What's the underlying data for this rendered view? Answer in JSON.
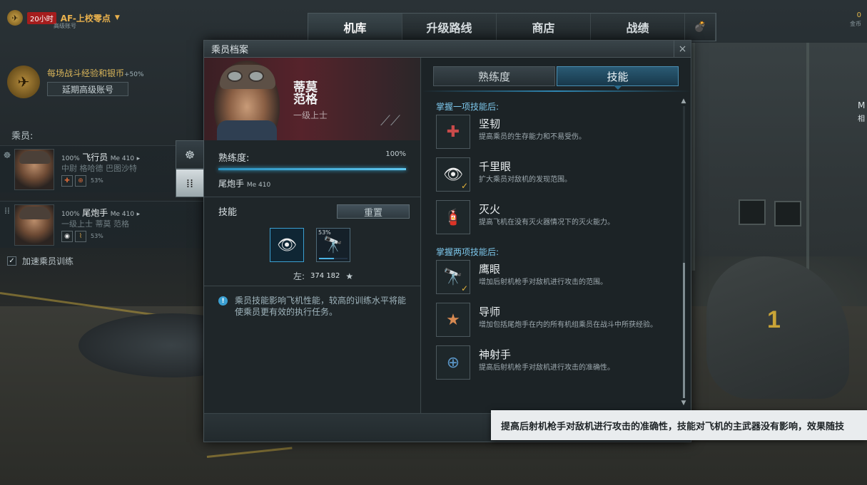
{
  "user": {
    "timer": "20小时",
    "name": "AF-上校零点",
    "subtitle": "高级账号"
  },
  "nav": {
    "tabs": [
      {
        "label": "机库"
      },
      {
        "label": "升级路线"
      },
      {
        "label": "商店"
      },
      {
        "label": "战绩"
      }
    ]
  },
  "gold": {
    "value": "0",
    "label": "金币"
  },
  "premium": {
    "text": "每场战斗经验和银币",
    "bonus": "+50%",
    "button": "延期高级账号"
  },
  "crew": {
    "label": "乘员:",
    "members": [
      {
        "percent": "100%",
        "role": "飞行员",
        "model": "Me 410",
        "name": "中尉 格哈德 巴图沙特",
        "skill_level": "53%"
      },
      {
        "percent": "100%",
        "role": "尾炮手",
        "model": "Me 410",
        "name": "一级上士 蒂莫 范格",
        "skill_level": "53%"
      }
    ],
    "accelerate_label": "加速乘员训练"
  },
  "dialog": {
    "title": "乘员档案",
    "close": "×",
    "crew_name_line1": "蒂莫",
    "crew_name_line2": "范格",
    "crew_rank": "一级上士",
    "proficiency_label": "熟练度:",
    "proficiency_value": "100%",
    "proficiency_fraction": 1.0,
    "role": "尾炮手",
    "role_model": "Me 410",
    "skills_label": "技能",
    "reset_button": "重置",
    "slot_percent": "53%",
    "slot_progress": 0.53,
    "remaining_label": "左:",
    "remaining_value": "374 182",
    "info_text": "乘员技能影响飞机性能，较高的训练水平将能使乘员更有效的执行任务。",
    "tabs": [
      {
        "label": "熟练度"
      },
      {
        "label": "技能"
      }
    ],
    "groups": [
      {
        "title": "掌握一项技能后:",
        "skills": [
          {
            "name": "坚韧",
            "desc": "提高乘员的生存能力和不易受伤。",
            "icon": "medkit-icon",
            "learned": false
          },
          {
            "name": "千里眼",
            "desc": "扩大乘员对敌机的发现范围。",
            "icon": "eye-icon",
            "learned": true
          },
          {
            "name": "灭火",
            "desc": "提高飞机在没有灭火器情况下的灭火能力。",
            "icon": "extinguisher-icon",
            "learned": false
          }
        ]
      },
      {
        "title": "掌握两项技能后:",
        "skills": [
          {
            "name": "鹰眼",
            "desc": "增加后射机枪手对敌机进行攻击的范围。",
            "icon": "telescope-icon",
            "learned": true
          },
          {
            "name": "导师",
            "desc": "增加包括尾炮手在内的所有机组乘员在战斗中所获经验。",
            "icon": "star-book-icon",
            "learned": false
          },
          {
            "name": "神射手",
            "desc": "提高后射机枪手对敌机进行攻击的准确性。",
            "icon": "crosshair-icon",
            "learned": false
          }
        ]
      }
    ],
    "tooltip": "提高后射机枪手对敌机进行攻击的准确性，技能对飞机的主武器没有影响，效果随技"
  },
  "right_edge": {
    "letter1": "M",
    "letter2": "相"
  }
}
